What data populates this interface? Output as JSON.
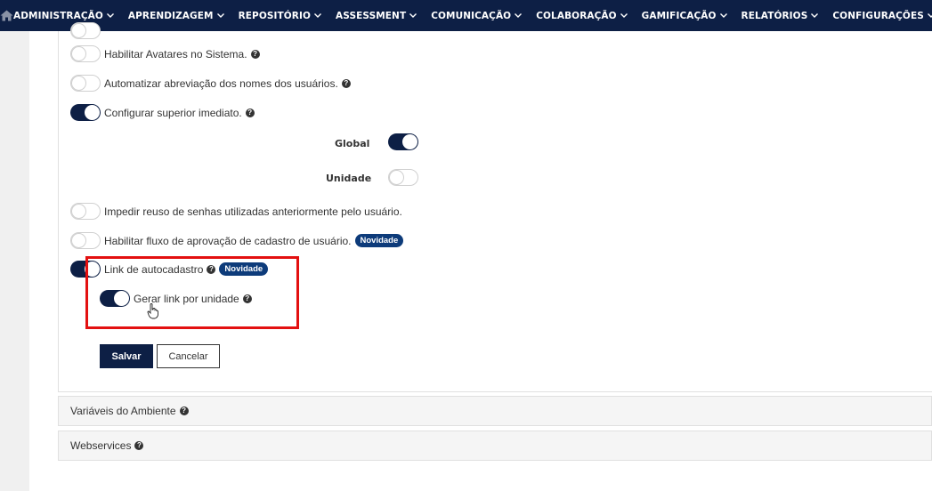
{
  "nav": {
    "home_icon": "home-icon",
    "items": [
      {
        "label": "ADMINISTRAÇÃO"
      },
      {
        "label": "APRENDIZAGEM"
      },
      {
        "label": "REPOSITÓRIO"
      },
      {
        "label": "ASSESSMENT"
      },
      {
        "label": "COMUNICAÇÃO"
      },
      {
        "label": "COLABORAÇÃO"
      },
      {
        "label": "GAMIFICAÇÃO"
      },
      {
        "label": "RELATÓRIOS"
      },
      {
        "label": "CONFIGURAÇÕES"
      }
    ]
  },
  "settings": {
    "avatars": {
      "label": "Habilitar Avatares no Sistema.",
      "enabled": false
    },
    "abbreviate": {
      "label": "Automatizar abreviação dos nomes dos usuários.",
      "enabled": false
    },
    "superior": {
      "label": "Configurar superior imediato.",
      "enabled": true
    },
    "global": {
      "label": "Global",
      "enabled": true
    },
    "unidade": {
      "label": "Unidade",
      "enabled": false
    },
    "password_reuse": {
      "label": "Impedir reuso de senhas utilizadas anteriormente pelo usuário.",
      "enabled": false
    },
    "approval_flow": {
      "label": "Habilitar fluxo de aprovação de cadastro de usuário.",
      "badge": "Novidade",
      "enabled": false
    },
    "autocadastro": {
      "label": "Link de autocadastro",
      "badge": "Novidade",
      "enabled": true
    },
    "link_por_unidade": {
      "label": "Gerar link por unidade",
      "enabled": true
    }
  },
  "actions": {
    "save_label": "Salvar",
    "cancel_label": "Cancelar"
  },
  "sections": [
    {
      "label": "Variáveis do Ambiente"
    },
    {
      "label": "Webservices"
    }
  ],
  "colors": {
    "primary": "#0d1f45",
    "badge": "#0d3b7a",
    "highlight": "#e31010"
  }
}
